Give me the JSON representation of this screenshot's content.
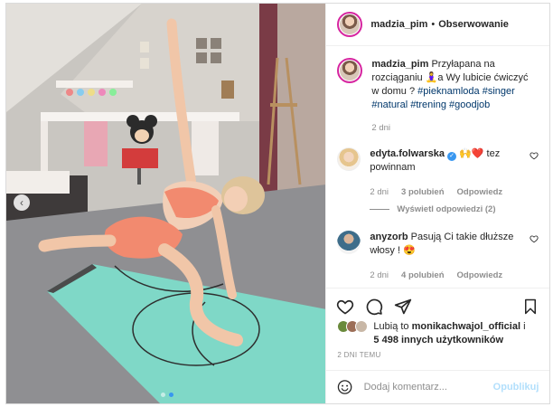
{
  "header": {
    "username": "madzia_pim",
    "separator": "•",
    "follow_label": "Obserwowanie"
  },
  "caption": {
    "username": "madzia_pim",
    "text": "Przyłapana na rozciąganiu 🧘‍♀️a Wy lubicie ćwiczyć w domu ?",
    "hashtags": "#pieknamloda #singer #natural #trening #goodjob",
    "time": "2 dni"
  },
  "comments": [
    {
      "username": "edyta.folwarska",
      "text": "🙌❤️ tez powinnam",
      "time": "2 dni",
      "likes": "3 polubień",
      "reply": "Odpowiedz",
      "view_replies": "Wyświetl odpowiedzi (2)"
    },
    {
      "username": "anyzorb",
      "text": "Pasują Ci takie dłuższe włosy ! 😍",
      "time": "2 dni",
      "likes": "4 polubień",
      "reply": "Odpowiedz"
    }
  ],
  "likes": {
    "prefix": "Lubią to ",
    "user": "monikachwajol_official",
    "suffix": " i",
    "count": "5 498 innych użytkowników"
  },
  "post_time": "2 DNI TEMU",
  "comment_box": {
    "placeholder": "Dodaj komentarz...",
    "post_label": "Opublikuj"
  },
  "icons": {
    "like": "heart-icon",
    "comment": "comment-icon",
    "share": "share-icon",
    "save": "bookmark-icon",
    "emoji": "emoji-icon",
    "nav": "chevron-left-icon"
  },
  "colors": {
    "link": "#00376b",
    "verified": "#3897f0",
    "mat": "#7fd8c7",
    "outfit": "#f28a6f"
  },
  "carousel": {
    "slides": 2,
    "active": 2
  }
}
